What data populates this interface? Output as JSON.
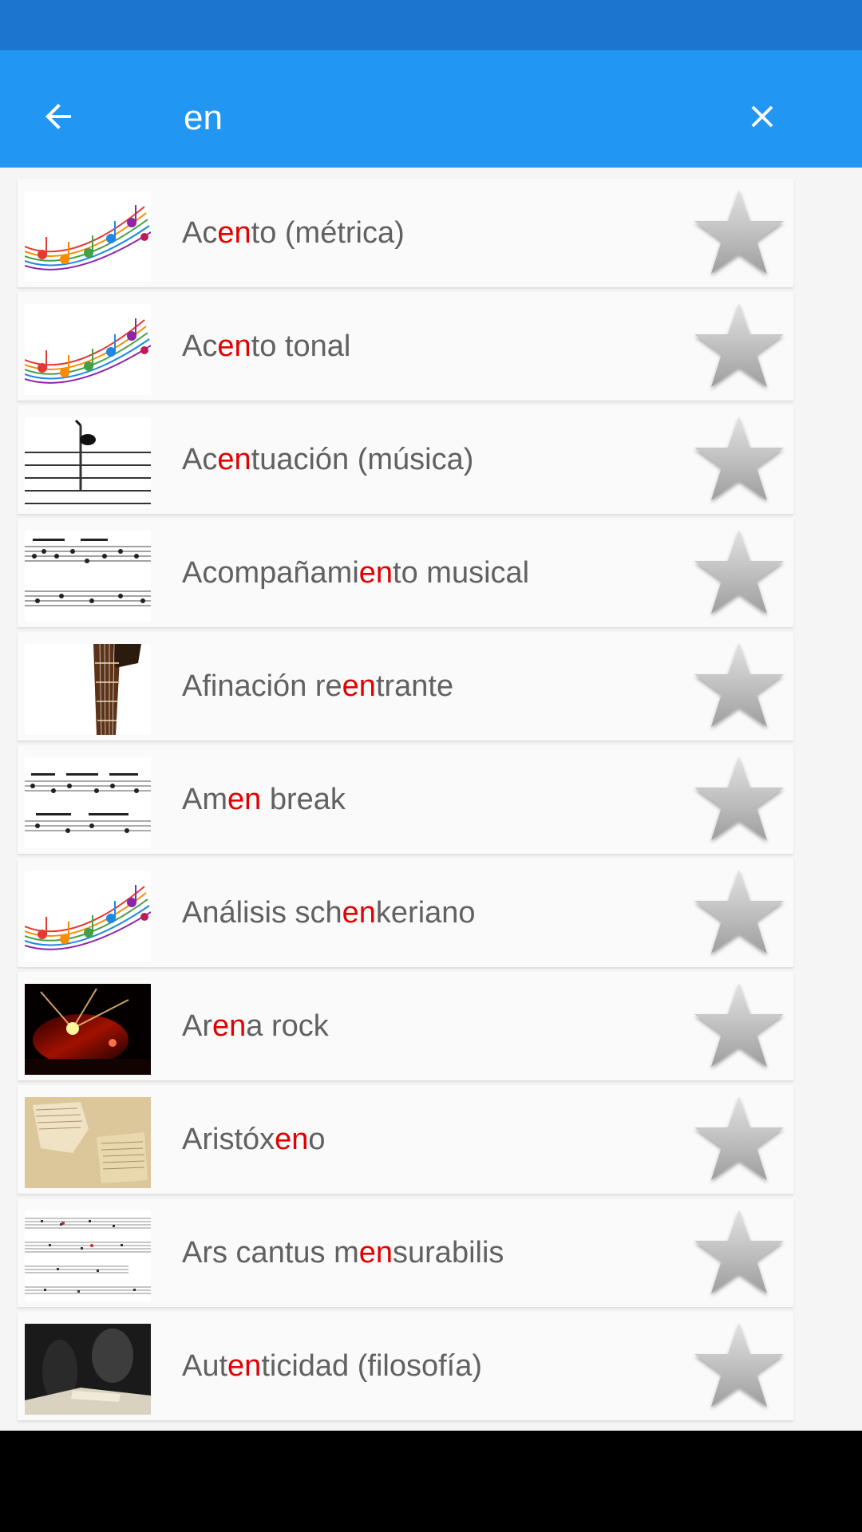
{
  "search": {
    "query": "en"
  },
  "icons": {
    "back": "arrow-back-icon",
    "close": "close-icon",
    "favorite": "star-icon"
  },
  "colors": {
    "status_bar": "#1C75CF",
    "app_bar": "#2196F3",
    "highlight": "#E30000",
    "text": "#616161"
  },
  "results": [
    {
      "pre": "Ac",
      "match": "en",
      "post": "to (métrica)",
      "thumbnail": "colorful-music-notes"
    },
    {
      "pre": "Ac",
      "match": "en",
      "post": "to tonal",
      "thumbnail": "colorful-music-notes"
    },
    {
      "pre": "Ac",
      "match": "en",
      "post": "tuación (música)",
      "thumbnail": "single-note-staff"
    },
    {
      "pre": "Acompañami",
      "match": "en",
      "post": "to musical",
      "thumbnail": "sheet-music"
    },
    {
      "pre": "Afinación re",
      "match": "en",
      "post": "trante",
      "thumbnail": "guitar-neck"
    },
    {
      "pre": "Am",
      "match": "en",
      "post": " break",
      "thumbnail": "drum-notation"
    },
    {
      "pre": "Análisis sch",
      "match": "en",
      "post": "keriano",
      "thumbnail": "colorful-music-notes"
    },
    {
      "pre": "Ar",
      "match": "en",
      "post": "a rock",
      "thumbnail": "concert-stage"
    },
    {
      "pre": "Aristóx",
      "match": "en",
      "post": "o",
      "thumbnail": "ancient-papyrus"
    },
    {
      "pre": "Ars cantus m",
      "match": "en",
      "post": "surabilis",
      "thumbnail": "medieval-score"
    },
    {
      "pre": "Aut",
      "match": "en",
      "post": "ticidad (filosofía)",
      "thumbnail": "dark-portrait"
    }
  ]
}
